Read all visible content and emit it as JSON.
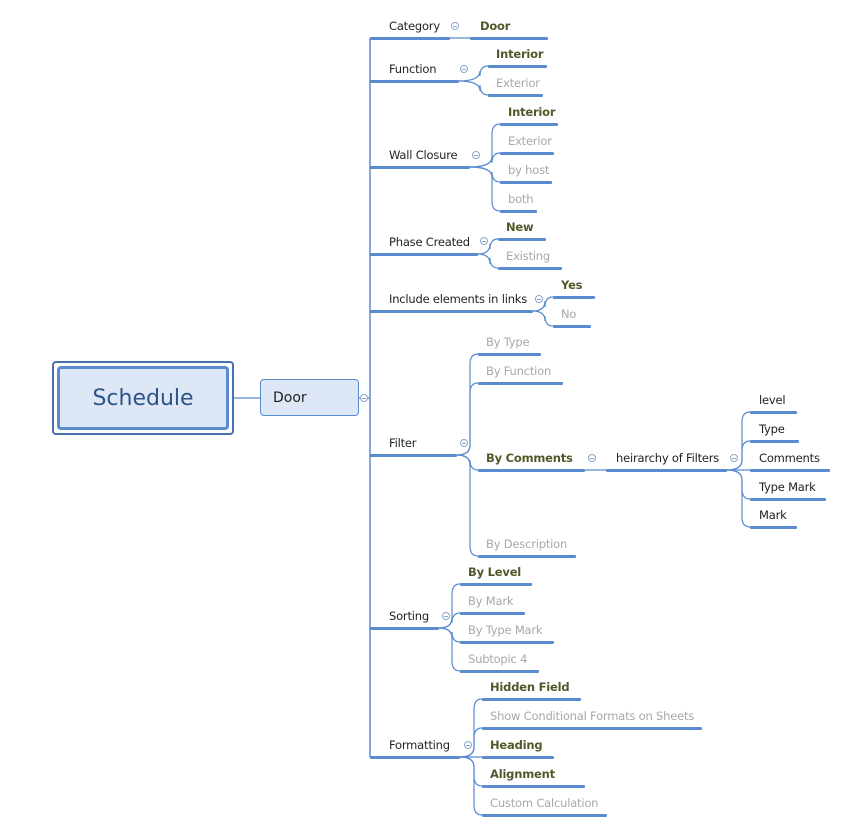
{
  "root": {
    "label": "Schedule"
  },
  "main_topic": {
    "label": "Door"
  },
  "branches": [
    {
      "label": "Category",
      "children": [
        {
          "label": "Door",
          "state": "selected"
        }
      ]
    },
    {
      "label": "Function",
      "children": [
        {
          "label": "Interior",
          "state": "selected"
        },
        {
          "label": "Exterior",
          "state": "dim"
        }
      ]
    },
    {
      "label": "Wall Closure",
      "children": [
        {
          "label": "Interior",
          "state": "selected"
        },
        {
          "label": "Exterior",
          "state": "dim"
        },
        {
          "label": "by host",
          "state": "dim"
        },
        {
          "label": "both",
          "state": "dim"
        }
      ]
    },
    {
      "label": "Phase Created",
      "children": [
        {
          "label": "New",
          "state": "selected"
        },
        {
          "label": "Existing",
          "state": "dim"
        }
      ]
    },
    {
      "label": "Include elements in links",
      "children": [
        {
          "label": "Yes",
          "state": "selected"
        },
        {
          "label": "No",
          "state": "dim"
        }
      ]
    },
    {
      "label": "Filter",
      "children": [
        {
          "label": "By Type",
          "state": "dim"
        },
        {
          "label": "By Function",
          "state": "dim"
        },
        {
          "label": "By Comments",
          "state": "selected",
          "sub": {
            "label": "heirarchy of Filters",
            "children": [
              "level",
              "Type",
              "Comments",
              "Type Mark",
              "Mark"
            ]
          }
        },
        {
          "label": "By Description",
          "state": "dim"
        }
      ]
    },
    {
      "label": "Sorting",
      "children": [
        {
          "label": "By Level",
          "state": "selected"
        },
        {
          "label": "By Mark",
          "state": "dim"
        },
        {
          "label": "By Type Mark",
          "state": "dim"
        },
        {
          "label": "Subtopic 4",
          "state": "dim"
        }
      ]
    },
    {
      "label": "Formatting",
      "children": [
        {
          "label": "Hidden Field",
          "state": "selected"
        },
        {
          "label": "Show Conditional Formats on Sheets",
          "state": "dim"
        },
        {
          "label": "Heading",
          "state": "selected"
        },
        {
          "label": "Alignment",
          "state": "selected"
        },
        {
          "label": "Custom Calculation",
          "state": "dim"
        }
      ]
    }
  ],
  "colors": {
    "line": "#5b8bcf",
    "selected_text": "#4f5a2a",
    "dim_text": "#a8a8a8",
    "root_fill": "#dde7f5",
    "root_text": "#2e5389"
  }
}
